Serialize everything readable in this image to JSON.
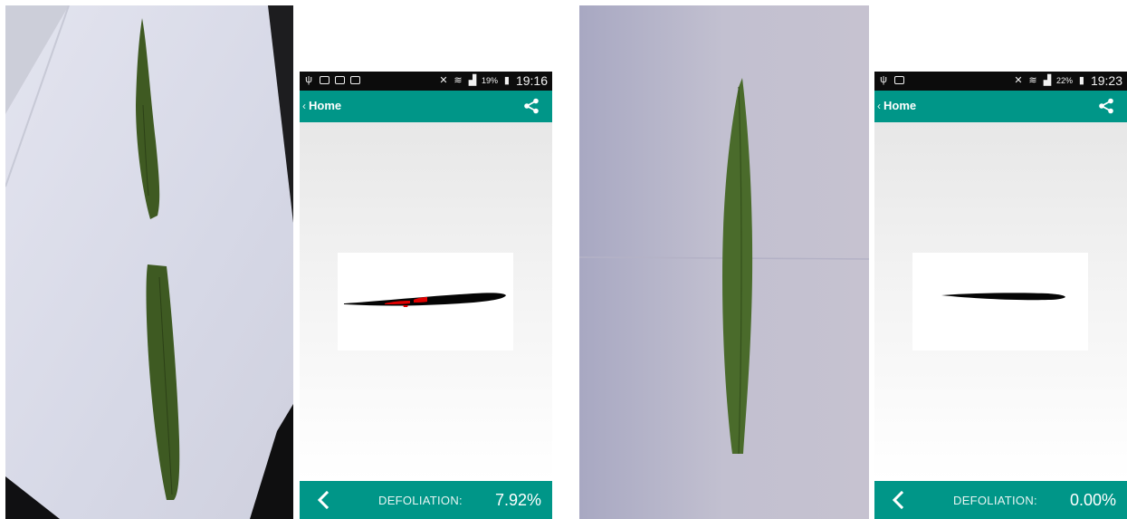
{
  "screens": [
    {
      "status": {
        "battery": "19%",
        "time": "19:16"
      },
      "appbar": {
        "back_label": "Home"
      },
      "result": {
        "defoliation_label": "DEFOLIATION:",
        "defoliation_value": "7.92%"
      }
    },
    {
      "status": {
        "battery": "22%",
        "time": "19:23"
      },
      "appbar": {
        "back_label": "Home"
      },
      "result": {
        "defoliation_label": "DEFOLIATION:",
        "defoliation_value": "0.00%"
      }
    }
  ],
  "colors": {
    "accent": "#009688",
    "statusbar": "#0c0c0c",
    "damage": "#e00000",
    "leaf": "#3f5a22"
  }
}
